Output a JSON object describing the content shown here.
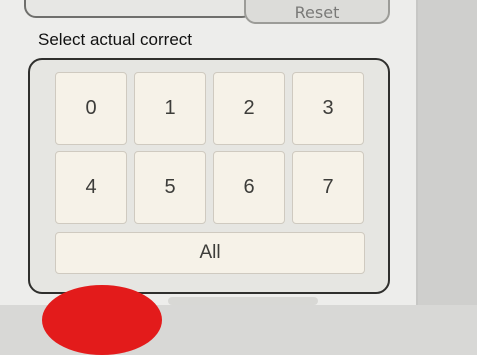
{
  "top": {
    "reset_label": "Reset"
  },
  "selector": {
    "label": "Select actual correct",
    "digits": [
      "0",
      "1",
      "2",
      "3",
      "4",
      "5",
      "6",
      "7"
    ],
    "all_label": "All"
  }
}
